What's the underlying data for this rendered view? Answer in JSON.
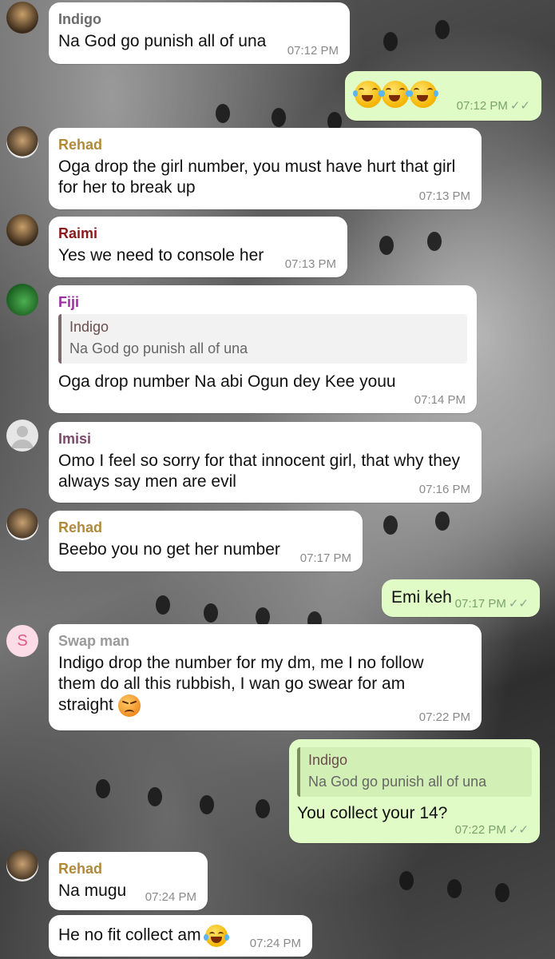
{
  "messages": [
    {
      "sender": "Indigo",
      "text": "Na God go punish all of una",
      "time": "07:12 PM"
    },
    {
      "time": "07:12 PM",
      "ticks": "✓✓"
    },
    {
      "sender": "Rehad",
      "text": "Oga drop the girl number, you must have hurt that girl for her to break up",
      "time": "07:13 PM"
    },
    {
      "sender": "Raimi",
      "text": "Yes we need to console her",
      "time": "07:13 PM"
    },
    {
      "sender": "Fiji",
      "quote_name": "Indigo",
      "quote_text": "Na God go punish all of una",
      "text": "Oga drop number Na abi Ogun dey Kee youu",
      "time": "07:14 PM"
    },
    {
      "sender": "Imisi",
      "text": "Omo I feel so sorry for that innocent girl, that why they always say men are evil",
      "time": "07:16 PM"
    },
    {
      "sender": "Rehad",
      "text": "Beebo you no get her number",
      "time": "07:17 PM"
    },
    {
      "text": "Emi keh",
      "time": "07:17 PM",
      "ticks": "✓✓"
    },
    {
      "sender": "Swap man",
      "avatar_letter": "S",
      "text": "Indigo drop the number for my dm, me I no follow them do all this rubbish, I wan go swear for am straight",
      "time": "07:22 PM"
    },
    {
      "quote_name": "Indigo",
      "quote_text": "Na God go punish all of una",
      "text": "You collect your 14?",
      "time": "07:22 PM",
      "ticks": "✓✓"
    },
    {
      "sender": "Rehad",
      "text": "Na mugu",
      "time": "07:24 PM"
    },
    {
      "text": "He no fit collect am",
      "time": "07:24 PM"
    }
  ],
  "colors": {
    "indigo": "#6b6b6b",
    "rehad": "#b08a3a",
    "raimi": "#8b1a1a",
    "fiji": "#9b2ea0",
    "imisi": "#7a4a6a",
    "swapman": "#9a9a9a",
    "outgoing_bubble": "#e0fbc6"
  }
}
